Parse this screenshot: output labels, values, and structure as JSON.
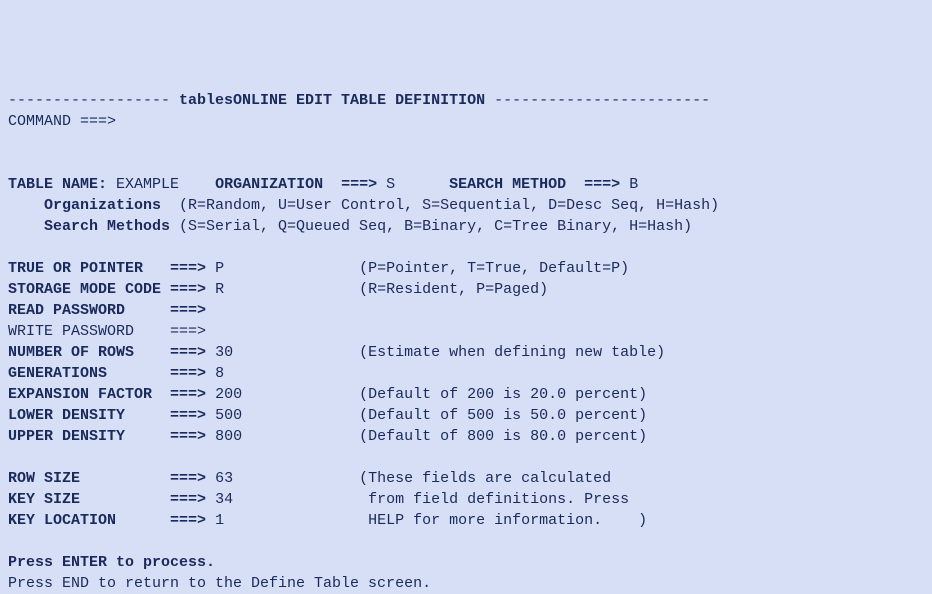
{
  "header": {
    "dash_left": "------------------ ",
    "title": "tablesONLINE EDIT TABLE DEFINITION",
    "dash_right": " ------------------------"
  },
  "command": {
    "label": "COMMAND ===>",
    "value": ""
  },
  "top": {
    "table_name_label": "TABLE NAME:",
    "table_name_value": "EXAMPLE",
    "organization_label": "ORGANIZATION  ===>",
    "organization_value": "S",
    "search_method_label": "SEARCH METHOD  ===>",
    "search_method_value": "B",
    "organizations_label": "    Organizations",
    "organizations_hint": "  (R=Random, U=User Control, S=Sequential, D=Desc Seq, H=Hash)",
    "search_methods_label": "    Search Methods",
    "search_methods_hint": " (S=Serial, Q=Queued Seq, B=Binary, C=Tree Binary, H=Hash)"
  },
  "fields": {
    "true_or_pointer": {
      "label": "TRUE OR POINTER   ===>",
      "value": "P",
      "hint": "(P=Pointer, T=True, Default=P)"
    },
    "storage_mode_code": {
      "label": "STORAGE MODE CODE ===>",
      "value": "R",
      "hint": "(R=Resident, P=Paged)"
    },
    "read_password": {
      "label": "READ PASSWORD     ===>",
      "value": "",
      "hint": ""
    },
    "write_password": {
      "label": "WRITE PASSWORD    ===>",
      "value": "",
      "hint": ""
    },
    "number_of_rows": {
      "label": "NUMBER OF ROWS    ===>",
      "value": "30",
      "hint": "(Estimate when defining new table)"
    },
    "generations": {
      "label": "GENERATIONS       ===>",
      "value": "8",
      "hint": ""
    },
    "expansion_factor": {
      "label": "EXPANSION FACTOR  ===>",
      "value": "200",
      "hint": "(Default of 200 is 20.0 percent)"
    },
    "lower_density": {
      "label": "LOWER DENSITY     ===>",
      "value": "500",
      "hint": "(Default of 500 is 50.0 percent)"
    },
    "upper_density": {
      "label": "UPPER DENSITY     ===>",
      "value": "800",
      "hint": "(Default of 800 is 80.0 percent)"
    },
    "row_size": {
      "label": "ROW SIZE          ===>",
      "value": "63",
      "hint": "(These fields are calculated"
    },
    "key_size": {
      "label": "KEY SIZE          ===>",
      "value": "34",
      "hint": " from field definitions. Press"
    },
    "key_location": {
      "label": "KEY LOCATION      ===>",
      "value": "1",
      "hint": " HELP for more information.    )"
    }
  },
  "footer": {
    "line1": "Press ENTER to process.",
    "line2": "Press END to return to the Define Table screen."
  }
}
